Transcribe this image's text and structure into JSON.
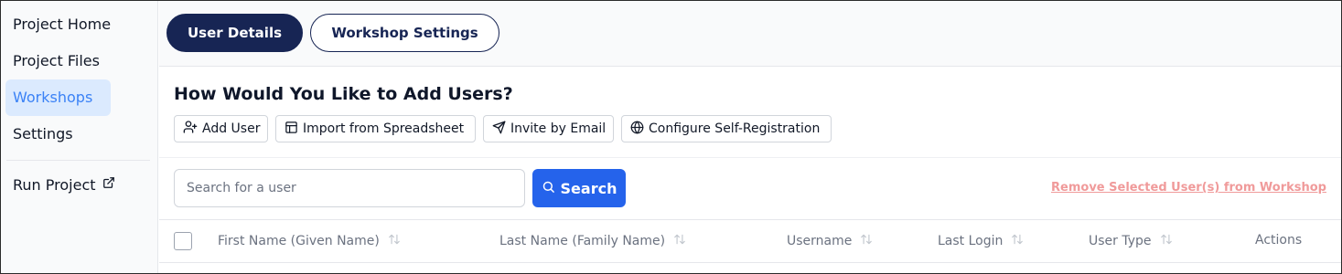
{
  "sidebar": {
    "items": [
      {
        "label": "Project Home"
      },
      {
        "label": "Project Files"
      },
      {
        "label": "Workshops"
      },
      {
        "label": "Settings"
      }
    ],
    "run_project": {
      "label": "Run Project",
      "icon": "external-link-icon"
    }
  },
  "tabs": [
    {
      "label": "User Details",
      "active": true
    },
    {
      "label": "Workshop Settings",
      "active": false
    }
  ],
  "add_users": {
    "heading": "How Would You Like to Add Users?",
    "buttons": [
      {
        "label": "Add User",
        "icon": "user-plus-icon"
      },
      {
        "label": "Import from Spreadsheet",
        "icon": "table-icon"
      },
      {
        "label": "Invite by Email",
        "icon": "send-icon"
      },
      {
        "label": "Configure Self-Registration",
        "icon": "globe-icon"
      }
    ]
  },
  "search": {
    "placeholder": "Search for a user",
    "button_label": "Search",
    "icon": "search-icon"
  },
  "remove_selected_label": "Remove Selected User(s) from Workshop",
  "table": {
    "columns": [
      {
        "label": "First Name (Given Name)",
        "sortable": true
      },
      {
        "label": "Last Name (Family Name)",
        "sortable": true
      },
      {
        "label": "Username",
        "sortable": true
      },
      {
        "label": "Last Login",
        "sortable": true
      },
      {
        "label": "User Type",
        "sortable": true
      },
      {
        "label": "Actions",
        "sortable": false
      }
    ]
  },
  "colors": {
    "active_tab": "#172554",
    "primary": "#2563eb",
    "sidebar_active_bg": "#dbeafe",
    "sidebar_active_text": "#3b82f6",
    "danger_link": "#f09a9a"
  }
}
